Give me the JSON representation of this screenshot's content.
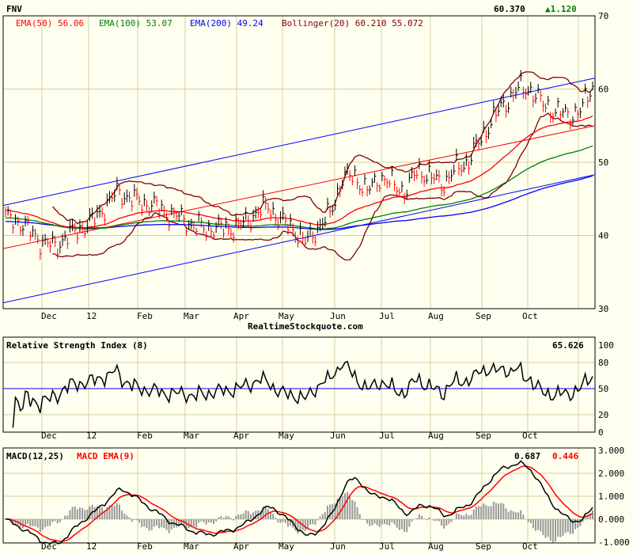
{
  "header": {
    "symbol": "FNV",
    "last": "60.370",
    "change": "▲1.120"
  },
  "legend": {
    "ema50": "EMA(50) 56.06",
    "ema100": "EMA(100) 53.07",
    "ema200": "EMA(200) 49.24",
    "boll": "Bollinger(20) 60.210 55.072"
  },
  "watermark": "RealtimeStockquote.com",
  "rsi": {
    "title": "Relative Strength Index (8)",
    "value": "65.626"
  },
  "macd": {
    "title": "MACD(12,25)",
    "ema_title": "MACD EMA(9)",
    "value": "0.687",
    "ema_value": "0.446"
  },
  "colors": {
    "ema50": "#ff0000",
    "ema100": "#008000",
    "ema200": "#0000ff",
    "boll": "#800000",
    "grid": "#d0d0a0",
    "bg": "#fffff0"
  },
  "chart_data": [
    {
      "type": "ohlc",
      "title": "FNV",
      "ylim": [
        30,
        70
      ],
      "yticks": [
        "70",
        "60",
        "50",
        "40",
        "30"
      ],
      "xticks": [
        "Dec",
        "12",
        "Feb",
        "Mar",
        "Apr",
        "May",
        "Jun",
        "Jul",
        "Aug",
        "Sep",
        "Oct"
      ],
      "close_keypoints": [
        42.5,
        42,
        40.5,
        39,
        38.5,
        40,
        41,
        42,
        44,
        46,
        45,
        44.5,
        44,
        43,
        42.5,
        41.5,
        41,
        41,
        41,
        41.5,
        43,
        44,
        42,
        41,
        39,
        41,
        43,
        48,
        48,
        46,
        48,
        47,
        46,
        49,
        48,
        47,
        49,
        50,
        53,
        56,
        58,
        60,
        60,
        58,
        57,
        56.5,
        57,
        60.37
      ],
      "channel": {
        "upper": [
          44.1,
          61.5
        ],
        "middle": [
          38.2,
          55.0
        ],
        "lower": [
          30.8,
          48.3
        ]
      }
    },
    {
      "type": "line",
      "title": "Relative Strength Index (8)",
      "ylim": [
        0,
        100
      ],
      "yticks": [
        "100",
        "80",
        "50",
        "20",
        "0"
      ],
      "reference": 50
    },
    {
      "type": "line",
      "title": "MACD(12,25)",
      "ylim": [
        -1,
        3
      ],
      "yticks": [
        "3.000",
        "2.000",
        "1.000",
        "0.000",
        "-1.000"
      ]
    }
  ]
}
